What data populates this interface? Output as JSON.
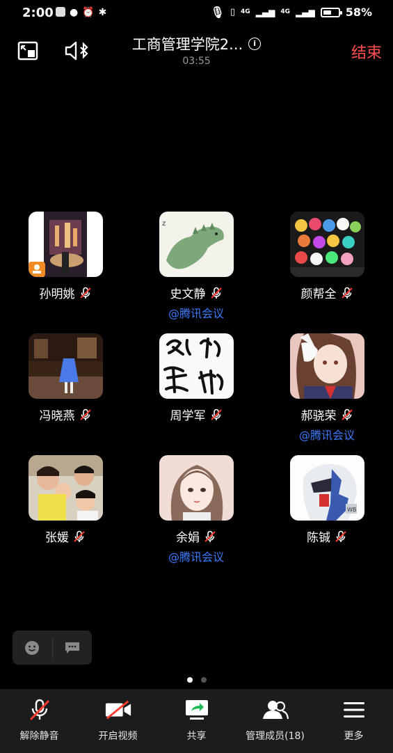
{
  "status_bar": {
    "time": "2:00",
    "network_left": "4G",
    "network_right": "4G",
    "battery": "58%",
    "battery_level": 0.58
  },
  "header": {
    "title": "工商管理学院2...",
    "timer": "03:55",
    "end_label": "结束"
  },
  "participants": [
    {
      "name": "孙明姚",
      "via": "",
      "muted": true,
      "host": true
    },
    {
      "name": "史文静",
      "via": "@腾讯会议",
      "muted": true,
      "host": false
    },
    {
      "name": "颜帮全",
      "via": "",
      "muted": true,
      "host": false
    },
    {
      "name": "冯晓燕",
      "via": "",
      "muted": true,
      "host": false
    },
    {
      "name": "周学军",
      "via": "",
      "muted": true,
      "host": false
    },
    {
      "name": "郝骁荣",
      "via": "@腾讯会议",
      "muted": true,
      "host": false
    },
    {
      "name": "张媛",
      "via": "",
      "muted": true,
      "host": false
    },
    {
      "name": "余娟",
      "via": "@腾讯会议",
      "muted": true,
      "host": false
    },
    {
      "name": "陈铖",
      "via": "",
      "muted": true,
      "host": false
    }
  ],
  "pager": {
    "pages": 2,
    "current": 1
  },
  "toolbar": {
    "unmute": "解除静音",
    "video": "开启视频",
    "share": "共享",
    "members": "管理成员(18)",
    "more": "更多"
  },
  "colors": {
    "end": "#ff4d4d",
    "via_link": "#3b7bff",
    "share_green": "#1db954",
    "mute_red": "#ff3b30"
  }
}
